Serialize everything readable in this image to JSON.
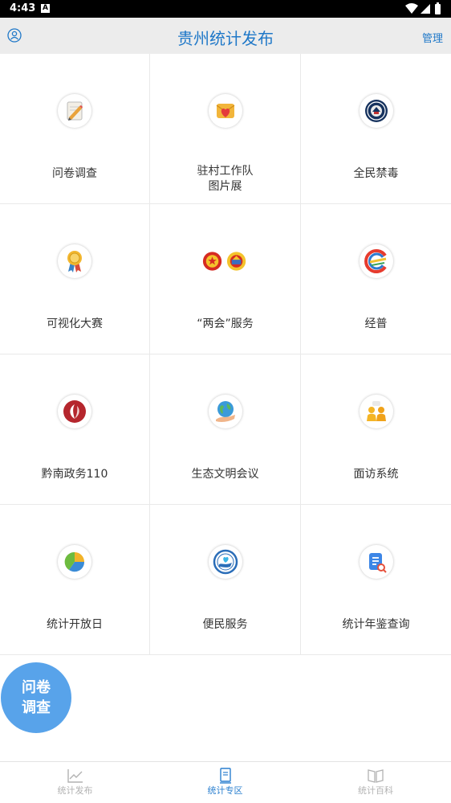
{
  "status_bar": {
    "time": "4:43",
    "notif": "A"
  },
  "header": {
    "title": "贵州统计发布",
    "manage": "管理"
  },
  "grid": [
    {
      "label": "问卷调查",
      "icon": "pencil-icon"
    },
    {
      "label": "驻村工作队",
      "label2": "图片展",
      "icon": "heart-envelope-icon"
    },
    {
      "label": "全民禁毒",
      "icon": "anti-drug-emblem-icon"
    },
    {
      "label": "可视化大赛",
      "icon": "medal-icon"
    },
    {
      "label": "“两会”服务",
      "icon": "national-emblem-icon"
    },
    {
      "label": "经普",
      "icon": "census-logo-icon"
    },
    {
      "label": "黔南政务110",
      "icon": "leaf-logo-icon"
    },
    {
      "label": "生态文明会议",
      "icon": "earth-hand-icon"
    },
    {
      "label": "面访系统",
      "icon": "interview-people-icon"
    },
    {
      "label": "统计开放日",
      "icon": "pie-chart-icon"
    },
    {
      "label": "便民服务",
      "icon": "service-emblem-icon"
    },
    {
      "label": "统计年鉴查询",
      "icon": "document-search-icon"
    }
  ],
  "fab": {
    "line1": "问卷",
    "line2": "调查"
  },
  "bottom_nav": [
    {
      "label": "统计发布",
      "icon": "line-chart-icon",
      "active": false
    },
    {
      "label": "统计专区",
      "icon": "bookmark-list-icon",
      "active": true
    },
    {
      "label": "统计百科",
      "icon": "open-book-icon",
      "active": false
    }
  ],
  "colors": {
    "accent": "#1f78c8",
    "fab": "#58a3ea",
    "inactive": "#b2b2b2"
  }
}
